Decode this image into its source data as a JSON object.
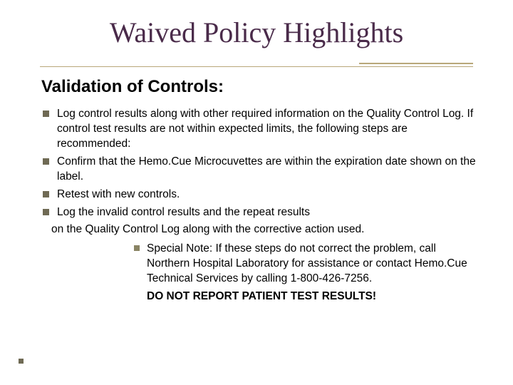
{
  "title": "Waived Policy Highlights",
  "subhead": "Validation of Controls:",
  "bullets": [
    "Log control results along with other required information on the Quality Control Log. If control test results are not within expected limits, the following steps are recommended:",
    "Confirm that the Hemo.Cue Microcuvettes are within the expiration date shown on the label.",
    "Retest with new controls.",
    "Log the invalid control results and the repeat results"
  ],
  "continuation": "on the Quality Control Log along with the corrective action used.",
  "special_note": "Special Note:  If these steps do not correct the problem, call Northern Hospital Laboratory for assistance or contact Hemo.Cue Technical Services by calling 1-800-426-7256.",
  "warning": "DO NOT REPORT PATIENT TEST RESULTS!"
}
